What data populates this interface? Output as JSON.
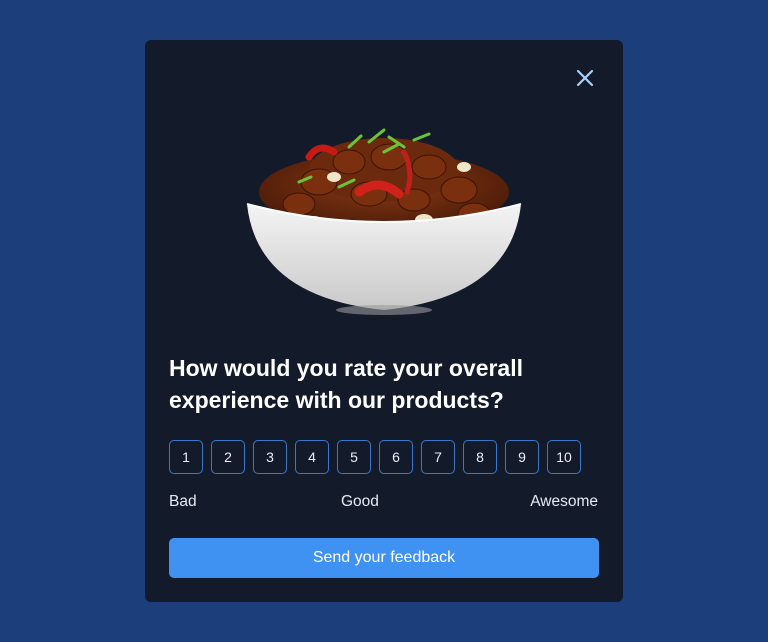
{
  "survey": {
    "question": "How would you rate your overall experience with our products?",
    "scale": [
      "1",
      "2",
      "3",
      "4",
      "5",
      "6",
      "7",
      "8",
      "9",
      "10"
    ],
    "labels": {
      "low": "Bad",
      "mid": "Good",
      "high": "Awesome"
    },
    "submit_label": "Send your feedback",
    "icons": {
      "close": "close-icon",
      "image": "food-bowl-image"
    }
  },
  "colors": {
    "background": "#1c3f7b",
    "card": "#131a2a",
    "accent": "#3f92f2",
    "scale_border": "#3b78c8",
    "close_icon": "#a7d1fb"
  }
}
